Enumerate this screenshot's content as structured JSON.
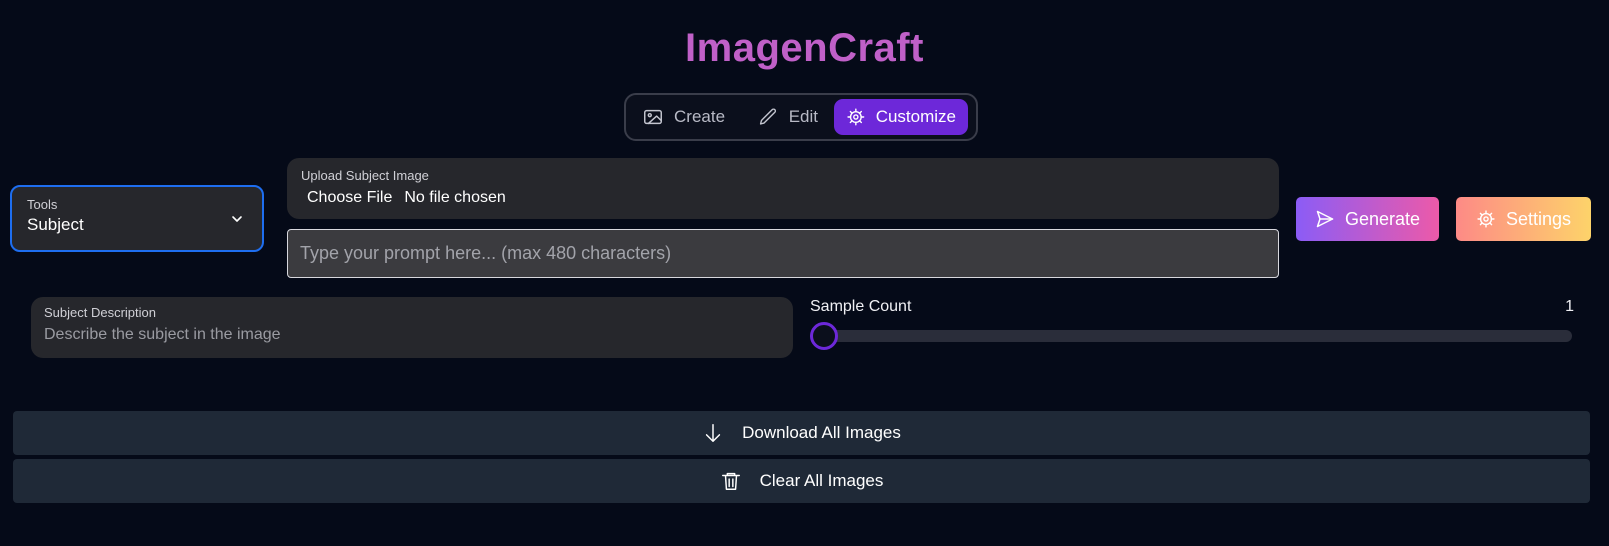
{
  "app": {
    "title": "ImagenCraft"
  },
  "tabs": [
    {
      "label": "Create",
      "icon": "image-icon",
      "active": false
    },
    {
      "label": "Edit",
      "icon": "pencil-icon",
      "active": false
    },
    {
      "label": "Customize",
      "icon": "gear-icon",
      "active": true
    }
  ],
  "tools": {
    "label": "Tools",
    "value": "Subject",
    "icon": "chevron-down-icon"
  },
  "upload": {
    "label": "Upload Subject Image",
    "button": "Choose File",
    "status": "No file chosen"
  },
  "prompt": {
    "value": "",
    "placeholder": "Type your prompt here... (max 480 characters)"
  },
  "actions": {
    "generate_label": "Generate",
    "generate_icon": "send-icon",
    "settings_label": "Settings",
    "settings_icon": "gear-icon"
  },
  "subject_description": {
    "label": "Subject Description",
    "value": "",
    "placeholder": "Describe the subject in the image"
  },
  "sample_count": {
    "label": "Sample Count",
    "value": "1",
    "min": 1,
    "max": 4,
    "level": 1
  },
  "bulk": {
    "download_label": "Download All Images",
    "download_icon": "arrow-down-icon",
    "clear_label": "Clear All Images",
    "clear_icon": "trash-icon"
  },
  "colors": {
    "background": "#050a18",
    "title": "#c060c8",
    "accent": "#6d28d9",
    "focus": "#1e6ef0",
    "panel": "#26272c",
    "bar": "#1f2937"
  }
}
